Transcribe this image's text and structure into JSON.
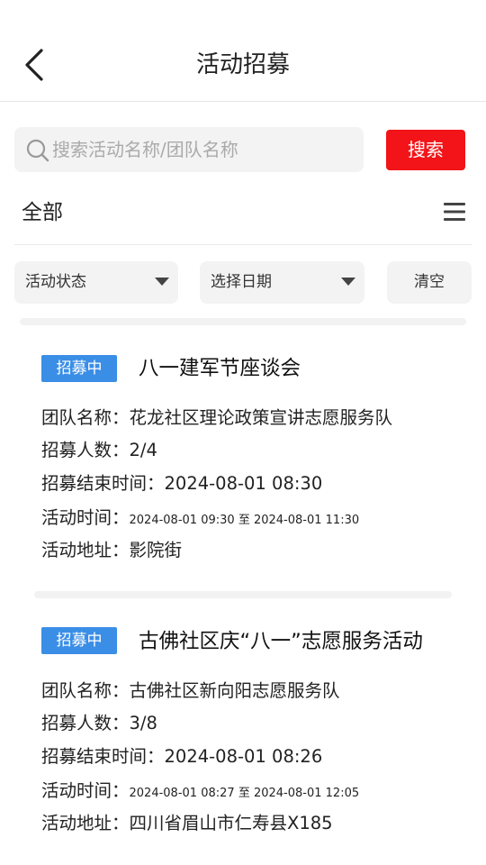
{
  "header": {
    "title": "活动招募"
  },
  "search": {
    "placeholder": "搜索活动名称/团队名称",
    "button_label": "搜索"
  },
  "filter": {
    "current": "全部",
    "status_dropdown": "活动状态",
    "date_dropdown": "选择日期",
    "clear_label": "清空"
  },
  "labels": {
    "team": "团队名称：",
    "count": "招募人数：",
    "end_time": "招募结束时间：",
    "activity_time": "活动时间：",
    "address": "活动地址：",
    "to": "至"
  },
  "activities": [
    {
      "badge": "招募中",
      "title": "八一建军节座谈会",
      "team": "花龙社区理论政策宣讲志愿服务队",
      "count": "2/4",
      "end_time": "2024-08-01 08:30",
      "start": "2024-08-01 09:30",
      "end": "2024-08-01 11:30",
      "address": "影院街"
    },
    {
      "badge": "招募中",
      "title": "古佛社区庆“八一”志愿服务活动",
      "team": "古佛社区新向阳志愿服务队",
      "count": "3/8",
      "end_time": "2024-08-01 08:26",
      "start": "2024-08-01 08:27",
      "end": "2024-08-01 12:05",
      "address": "四川省眉山市仁寿县X185"
    }
  ],
  "colors": {
    "accent_red": "#f21418",
    "badge_blue": "#3a8ee6"
  },
  "icons": [
    "back-arrow-icon",
    "search-icon",
    "menu-icon",
    "caret-down-icon"
  ]
}
